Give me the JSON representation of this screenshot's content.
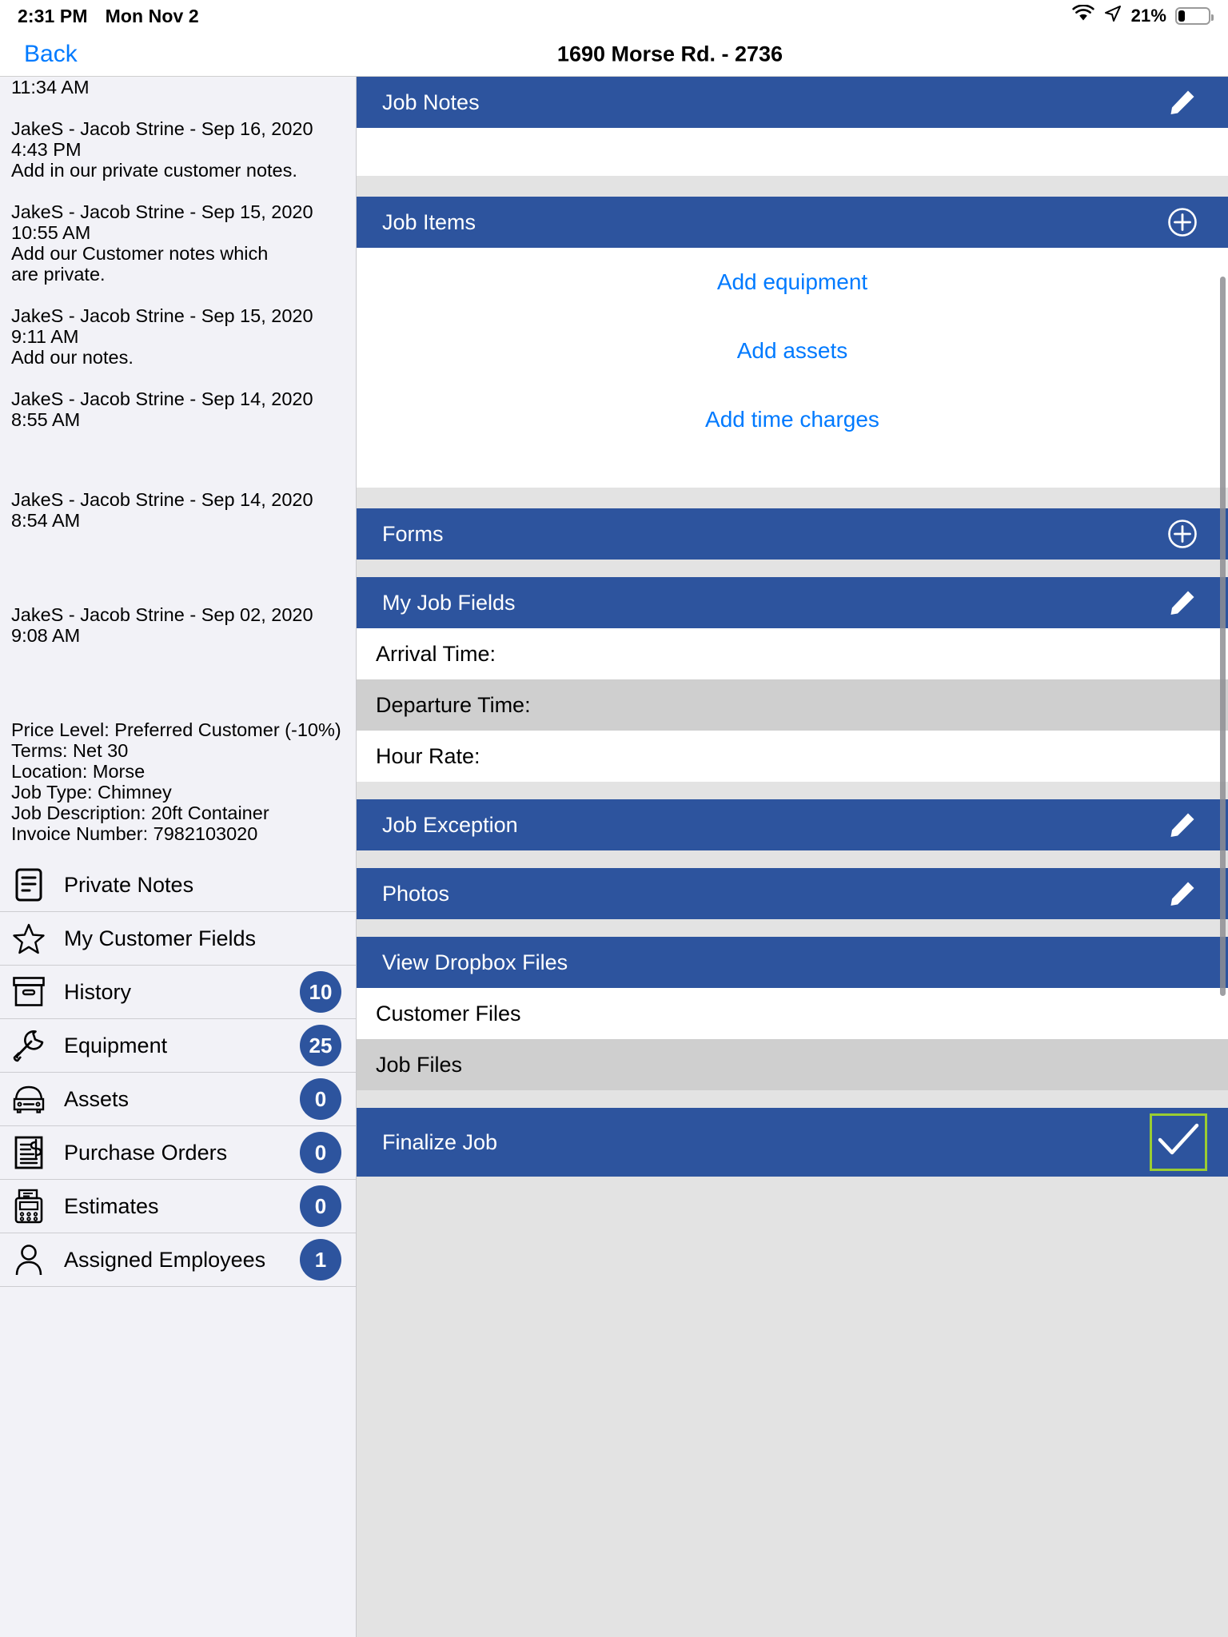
{
  "statusbar": {
    "time": "2:31 PM",
    "date": "Mon Nov 2",
    "battery_percent": "21%",
    "wifi_icon": "wifi-icon",
    "location_icon": "location-arrow-icon",
    "battery_icon": "battery-icon"
  },
  "navbar": {
    "back_label": "Back",
    "title": "1690 Morse Rd. - 2736"
  },
  "left_panel": {
    "notes": [
      {
        "header": "",
        "time": "11:34 AM",
        "body": ""
      },
      {
        "header": "JakeS - Jacob Strine - Sep 16, 2020",
        "time": "4:43 PM",
        "body": "Add in our private customer notes."
      },
      {
        "header": "JakeS - Jacob Strine - Sep 15, 2020",
        "time": "10:55 AM",
        "body": "Add our Customer notes which\nare private."
      },
      {
        "header": "JakeS - Jacob Strine - Sep 15, 2020",
        "time": "9:11 AM",
        "body": "Add our notes."
      },
      {
        "header": "JakeS - Jacob Strine - Sep 14, 2020",
        "time": "8:55 AM",
        "body": ""
      },
      {
        "header": "JakeS - Jacob Strine - Sep 14, 2020",
        "time": "8:54 AM",
        "body": ""
      },
      {
        "header": "JakeS - Jacob Strine - Sep 02, 2020",
        "time": "9:08 AM",
        "body": ""
      }
    ],
    "info": {
      "price_level": "Price Level: Preferred Customer (-10%)",
      "terms": "Terms: Net 30",
      "location": "Location: Morse",
      "job_type": "Job Type: Chimney",
      "job_description": "Job Description: 20ft Container",
      "invoice_number": "Invoice Number: 7982103020"
    },
    "menu": [
      {
        "label": "Private Notes",
        "icon": "notes-document-icon",
        "badge": null
      },
      {
        "label": "My Customer Fields",
        "icon": "star-icon",
        "badge": null
      },
      {
        "label": "History",
        "icon": "archive-box-icon",
        "badge": "10"
      },
      {
        "label": "Equipment",
        "icon": "wrench-icon",
        "badge": "25"
      },
      {
        "label": "Assets",
        "icon": "car-icon",
        "badge": "0"
      },
      {
        "label": "Purchase Orders",
        "icon": "invoice-dollar-icon",
        "badge": "0"
      },
      {
        "label": "Estimates",
        "icon": "calculator-icon",
        "badge": "0"
      },
      {
        "label": "Assigned Employees",
        "icon": "person-icon",
        "badge": "1"
      }
    ]
  },
  "right_panel": {
    "sections": [
      {
        "title": "Job Notes",
        "action_icon": "pencil-icon"
      },
      {
        "title": "Job Items",
        "action_icon": "plus-circle-icon"
      },
      {
        "title": "Forms",
        "action_icon": "plus-circle-icon"
      },
      {
        "title": "My Job Fields",
        "action_icon": "pencil-icon"
      },
      {
        "title": "Job Exception",
        "action_icon": "pencil-icon"
      },
      {
        "title": "Photos",
        "action_icon": "pencil-icon"
      },
      {
        "title": "View Dropbox Files",
        "action_icon": ""
      },
      {
        "title": "Finalize Job",
        "action_icon": "checkmark-icon"
      }
    ],
    "job_items_links": [
      "Add equipment",
      "Add assets",
      "Add time charges"
    ],
    "my_job_fields": [
      "Arrival Time:",
      "Departure Time:",
      "Hour Rate:"
    ],
    "dropbox_rows": [
      "Customer Files",
      "Job Files"
    ]
  },
  "colors": {
    "header_blue": "#2d549e",
    "link_blue": "#007aff",
    "checkbox_green": "#9acd32",
    "panel_bg": "#e3e3e3",
    "sidebar_bg": "#f2f2f7",
    "row_gray": "#cfcfcf"
  }
}
